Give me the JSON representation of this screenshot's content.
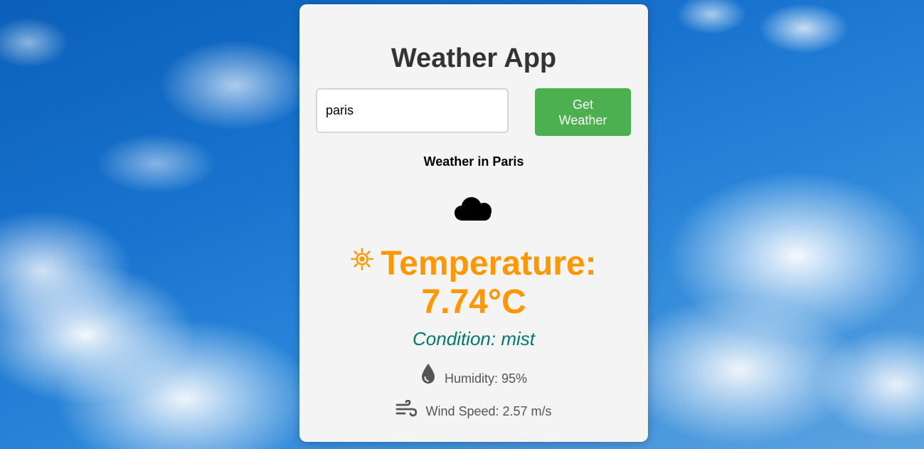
{
  "app": {
    "title": "Weather App"
  },
  "search": {
    "value": "paris",
    "button_label": "Get Weather"
  },
  "result": {
    "location_heading": "Weather in Paris",
    "weather_icon": "cloud-icon",
    "temperature_icon": "sun-icon",
    "temperature_text": "Temperature: 7.74°C",
    "condition_text": "Condition: mist",
    "humidity_icon": "water-drop-icon",
    "humidity_text": "Humidity: 95%",
    "wind_icon": "wind-icon",
    "wind_text": "Wind Speed: 2.57 m/s"
  },
  "colors": {
    "button": "#4caf50",
    "temperature": "#ff9800",
    "condition": "#00796b",
    "card": "#f4f4f4"
  }
}
